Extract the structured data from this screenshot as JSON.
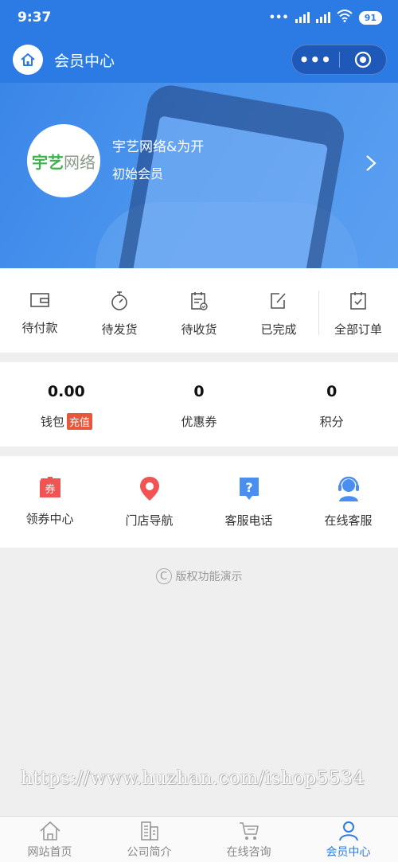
{
  "status_bar": {
    "time": "9:37",
    "network": "HD",
    "battery": "91"
  },
  "nav": {
    "title": "会员中心",
    "more_label": "•••"
  },
  "profile": {
    "name": "宇艺网络&为开",
    "level": "初始会员",
    "logo_text_green": "宇艺",
    "logo_text_gray": "网络"
  },
  "orders": [
    {
      "label": "待付款",
      "icon": "wallet-icon"
    },
    {
      "label": "待发货",
      "icon": "timer-icon"
    },
    {
      "label": "待收货",
      "icon": "calendar-check-icon"
    },
    {
      "label": "已完成",
      "icon": "edit-icon"
    },
    {
      "label": "全部订单",
      "icon": "checklist-icon"
    }
  ],
  "assets": [
    {
      "value": "0.00",
      "label": "钱包",
      "badge": "充值"
    },
    {
      "value": "0",
      "label": "优惠券"
    },
    {
      "value": "0",
      "label": "积分"
    }
  ],
  "services": [
    {
      "label": "领券中心",
      "icon": "coupon-icon",
      "color": "#f05454",
      "icon_text": "券"
    },
    {
      "label": "门店导航",
      "icon": "location-pin-icon",
      "color": "#f05454"
    },
    {
      "label": "客服电话",
      "icon": "help-bubble-icon",
      "color": "#4a8ff0",
      "icon_text": "?"
    },
    {
      "label": "在线客服",
      "icon": "headset-agent-icon",
      "color": "#4a8ff0"
    }
  ],
  "copyright": {
    "symbol": "C",
    "text": "版权功能演示"
  },
  "watermark": "https://www.huzhan.com/ishop5534",
  "tabs": [
    {
      "label": "网站首页",
      "icon": "home-icon",
      "active": false
    },
    {
      "label": "公司简介",
      "icon": "building-icon",
      "active": false
    },
    {
      "label": "在线咨询",
      "icon": "cart-icon",
      "active": false
    },
    {
      "label": "会员中心",
      "icon": "user-icon",
      "active": true
    }
  ],
  "colors": {
    "primary": "#2c7be5",
    "badge": "#e8563c",
    "red_icon": "#f05454",
    "blue_icon": "#4a8ff0"
  }
}
